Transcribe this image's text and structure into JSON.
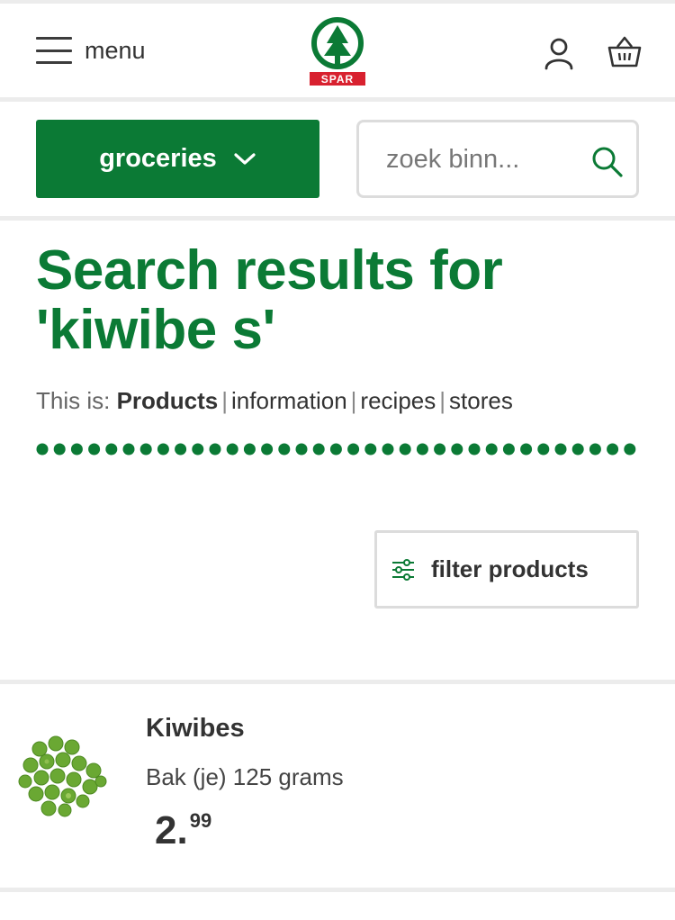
{
  "header": {
    "menu_label": "menu",
    "logo_text": "SPAR",
    "brand_color": "#0b7a35",
    "logo_red": "#d8212f"
  },
  "category": {
    "label": "groceries"
  },
  "search": {
    "placeholder": "zoek binn..."
  },
  "results": {
    "title": "Search results for 'kiwibe s'",
    "scope_prefix": "This is:",
    "scope_tabs": [
      "Products",
      "information",
      "recipes",
      "stores"
    ],
    "active_tab": "Products"
  },
  "filter": {
    "label": "filter products"
  },
  "products": [
    {
      "name": "Kiwibes",
      "size": "Bak (je) 125 grams",
      "price_euro": "2.",
      "price_cent": "99"
    }
  ]
}
